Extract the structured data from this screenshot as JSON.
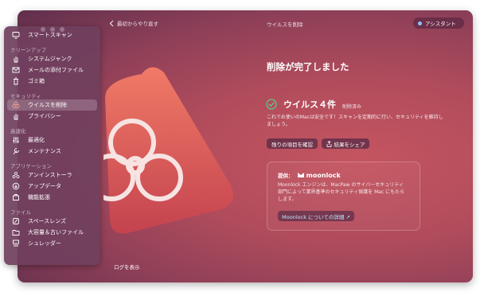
{
  "topbar": {
    "back_label": "最初からやり直す",
    "title": "ウイルスを削除",
    "assistant_label": "アシスタント"
  },
  "sidebar": {
    "smart_scan": "スマートスキャン",
    "sections": {
      "cleanup": "クリーンアップ",
      "security": "セキュリティ",
      "speed": "高速化",
      "apps": "アプリケーション",
      "files": "ファイル"
    },
    "items": {
      "system_junk": "システムジャンク",
      "mail_attachments": "メールの添付ファイル",
      "trash": "ゴミ箱",
      "malware_removal": "ウイルスを削除",
      "privacy": "プライバシー",
      "optimization": "最適化",
      "maintenance": "メンテナンス",
      "uninstaller": "アンインストーラ",
      "updater": "アップデータ",
      "extensions": "機能拡張",
      "space_lens": "スペースレンズ",
      "large_old_files": "大容量＆古いファイル",
      "shredder": "シュレッダー"
    }
  },
  "main": {
    "heading": "削除が完了しました",
    "result_title": "ウイルス４件",
    "result_badge": "削除済み",
    "description_line1": "これでお使いのMacは安全です！スキャンを定期的に行い、セキュリティを維持し",
    "description_line2": "ましょう。",
    "review_button": "残りの項目を確認",
    "share_button": "結果をシェア",
    "log_button": "ログを表示"
  },
  "moonlock": {
    "provided_by": "提供：",
    "brand": "moonlock",
    "text_line1": "Moonlock エンジンは、MacPaw のサイバーセキュリティ",
    "text_line2": "部門によって業界基準のセキュリティ保護を Mac にもたら",
    "text_line3": "します。",
    "link_label": "Moonlock についての詳細 ↗"
  },
  "colors": {
    "accent_check": "#5fc58a",
    "triangle_top": "#f07a66",
    "triangle_bottom": "#c4434f"
  }
}
